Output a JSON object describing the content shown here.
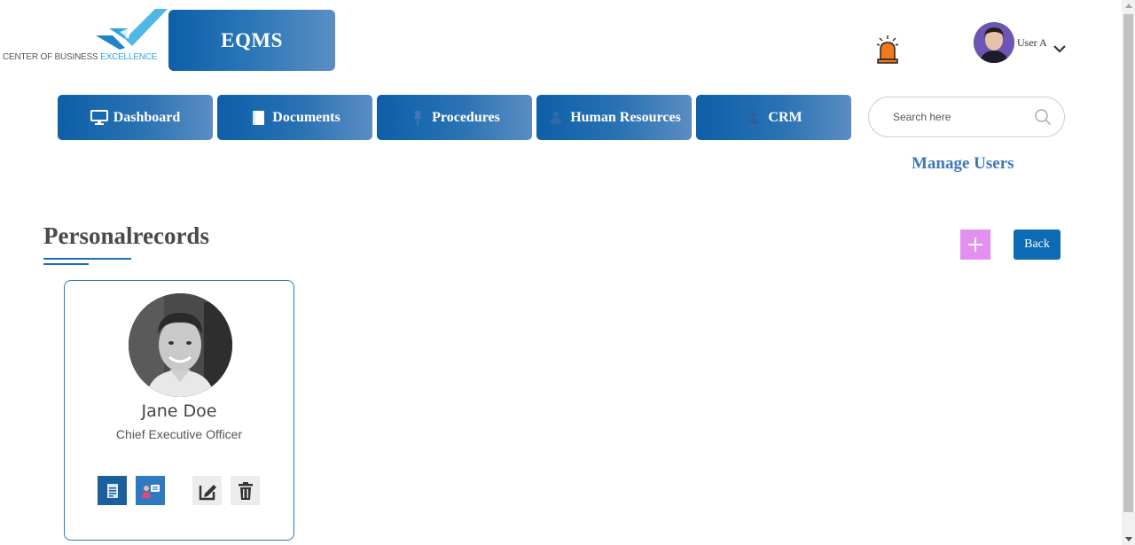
{
  "brand": {
    "logo_text_main": "CENTER OF BUSINESS ",
    "logo_text_accent": "EXCELLENCE",
    "app_label": "EQMS"
  },
  "header": {
    "user_name": "User A"
  },
  "nav": {
    "items": [
      {
        "label": "Dashboard",
        "icon": "monitor-icon"
      },
      {
        "label": "Documents",
        "icon": "book-icon"
      },
      {
        "label": "Procedures",
        "icon": "pin-icon"
      },
      {
        "label": "Human Resources",
        "icon": "person-icon"
      },
      {
        "label": "CRM",
        "icon": "user-icon"
      }
    ]
  },
  "search": {
    "placeholder": "Search here",
    "value": ""
  },
  "manage_users_label": "Manage Users",
  "section": {
    "title": "Personalrecords",
    "add_label": "+",
    "back_label": "Back"
  },
  "records": [
    {
      "name": "Jane Doe",
      "role": "Chief Executive Officer",
      "actions": [
        "document-icon",
        "id-card-icon",
        "edit-icon",
        "trash-icon"
      ]
    }
  ],
  "colors": {
    "primary": "#0d5fa8",
    "accent_link": "#3f78b8",
    "add_button": "#e28ff0",
    "back_button": "#0d6ab4",
    "alarm": "#f07a1e"
  }
}
